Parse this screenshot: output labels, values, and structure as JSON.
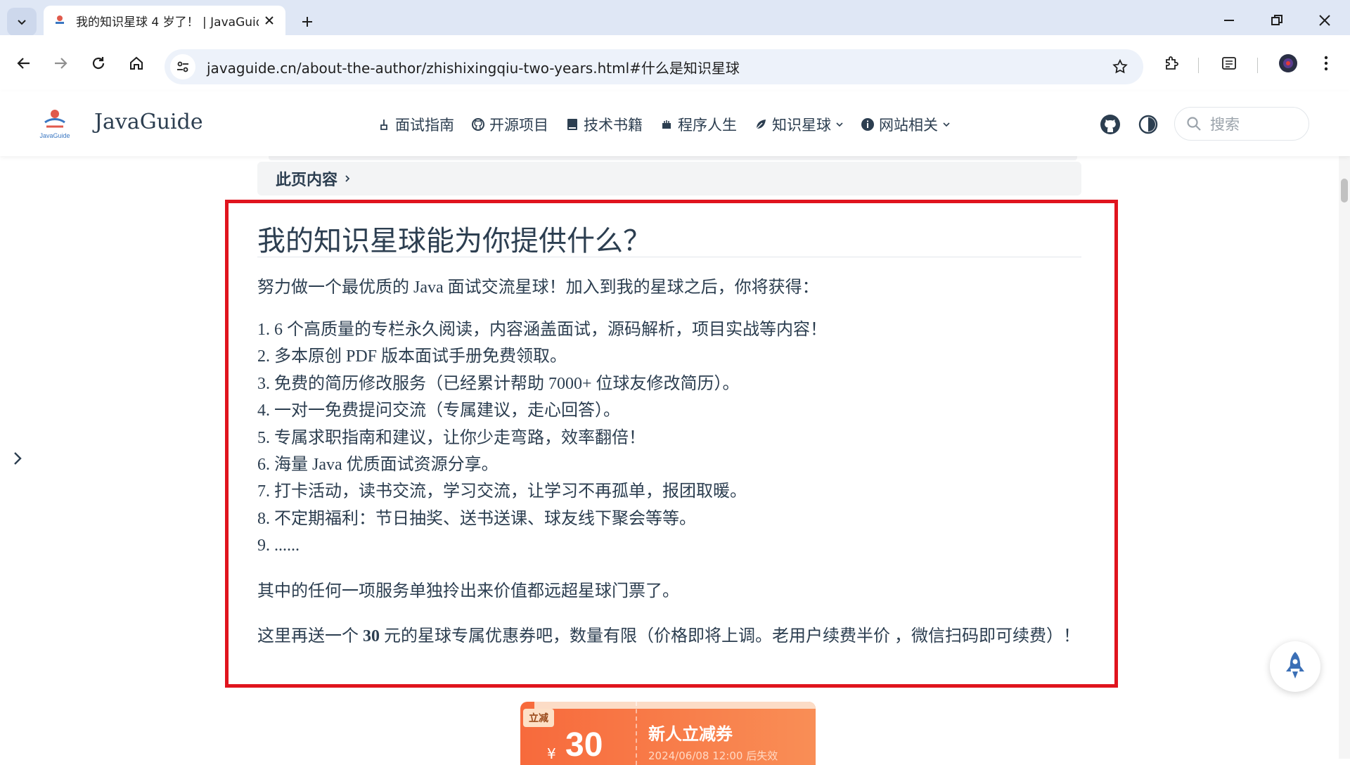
{
  "browser": {
    "tab_title": "我的知识星球 4 岁了！ | JavaGuide",
    "url": "javaguide.cn/about-the-author/zhishixingqiu-two-years.html#什么是知识星球"
  },
  "site": {
    "brand": "JavaGuide",
    "logo_text": "JavaGuide",
    "nav": [
      {
        "label": "面试指南",
        "icon": "interview-icon"
      },
      {
        "label": "开源项目",
        "icon": "github-icon"
      },
      {
        "label": "技术书籍",
        "icon": "book-icon"
      },
      {
        "label": "程序人生",
        "icon": "life-icon"
      },
      {
        "label": "知识星球",
        "icon": "leaf-icon"
      },
      {
        "label": "网站相关",
        "icon": "info-icon"
      }
    ],
    "search_placeholder": "搜索"
  },
  "article": {
    "toc_label": "此页内容",
    "heading": "我的知识星球能为你提供什么？",
    "intro": "努力做一个最优质的 Java 面试交流星球！加入到我的星球之后，你将获得：",
    "benefits": [
      "1. 6 个高质量的专栏永久阅读，内容涵盖面试，源码解析，项目实战等内容！",
      "2. 多本原创 PDF 版本面试手册免费领取。",
      "3. 免费的简历修改服务（已经累计帮助 7000+ 位球友修改简历）。",
      "4. 一对一免费提问交流（专属建议，走心回答）。",
      "5. 专属求职指南和建议，让你少走弯路，效率翻倍！",
      "6. 海量 Java 优质面试资源分享。",
      "7. 打卡活动，读书交流，学习交流，让学习不再孤单，报团取暖。",
      "8. 不定期福利：节日抽奖、送书送课、球友线下聚会等等。",
      "9. ......"
    ],
    "value_note": "其中的任何一项服务单独拎出来价值都远超星球门票了。",
    "coupon_note_pre": "这里再送一个 ",
    "coupon_note_num": "30",
    "coupon_note_post": " 元的星球专属优惠券吧，数量有限（价格即将上调。老用户续费半价 ，微信扫码即可续费）！"
  },
  "coupon": {
    "tag": "立减",
    "yen": "¥",
    "amount": "30",
    "name": "新人立减券",
    "sub": "2024/06/08 12:00 后失效"
  },
  "colors": {
    "highlight_border": "#e0141e",
    "accent": "#3eaf7c"
  }
}
